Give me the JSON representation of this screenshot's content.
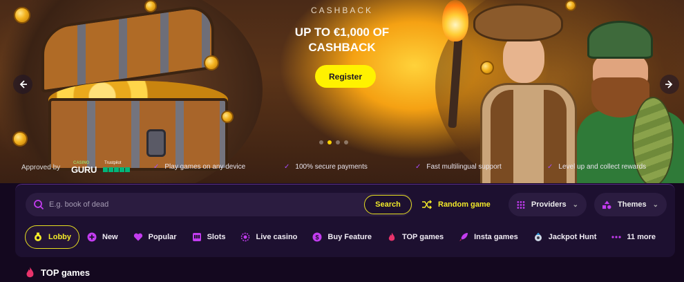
{
  "hero": {
    "kicker": "CASHBACK",
    "headline": "UP TO €1,000 OF CASHBACK",
    "register_label": "Register",
    "slides_total": 4,
    "active_slide": 2
  },
  "approval": {
    "approved_by": "Approved by",
    "casino_guru_small": "CASINO",
    "casino_guru_big": "GURU",
    "trustpilot": "Trustpilot"
  },
  "features": [
    "Play games on any device",
    "100% secure payments",
    "Fast multilingual support",
    "Level up and collect rewards"
  ],
  "search": {
    "placeholder": "E.g. book of dead",
    "button_label": "Search"
  },
  "random_game": "Random game",
  "providers": "Providers",
  "themes": "Themes",
  "categories": [
    {
      "label": "Lobby",
      "icon": "lobby-icon"
    },
    {
      "label": "New",
      "icon": "plus-circle-icon"
    },
    {
      "label": "Popular",
      "icon": "heart-icon"
    },
    {
      "label": "Slots",
      "icon": "slot-machine-icon"
    },
    {
      "label": "Live casino",
      "icon": "live-icon"
    },
    {
      "label": "Buy Feature",
      "icon": "dollar-icon"
    },
    {
      "label": "TOP games",
      "icon": "flame-icon"
    },
    {
      "label": "Insta games",
      "icon": "rocket-icon"
    },
    {
      "label": "Jackpot Hunt",
      "icon": "jackpot-icon"
    },
    {
      "label": "11 more",
      "icon": "more-dots-icon"
    }
  ],
  "section": {
    "title": "TOP games"
  },
  "colors": {
    "accent_yellow": "#f3ea29",
    "accent_purple": "#c33cf0",
    "panel_bg": "#1d1030",
    "page_bg": "#14081f"
  }
}
